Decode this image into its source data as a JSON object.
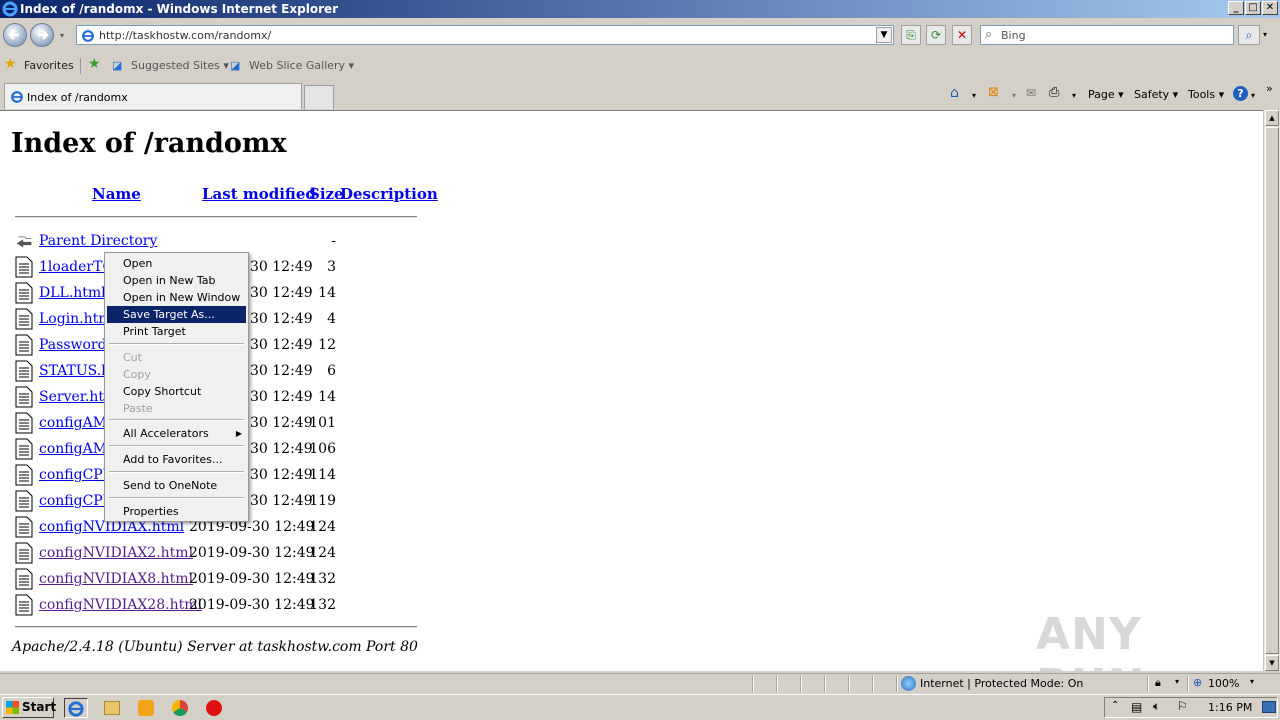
{
  "window": {
    "title": "Index of /randomx - Windows Internet Explorer",
    "minimize": "_",
    "maximize": "□",
    "close": "✕"
  },
  "address": {
    "url": "http://taskhostw.com/randomx/",
    "search_placeholder": "Bing"
  },
  "favorites_bar": {
    "favorites": "Favorites",
    "suggested_sites": "Suggested Sites ▾",
    "web_slice_gallery": "Web Slice Gallery ▾"
  },
  "tab": {
    "label": "Index of /randomx"
  },
  "command_bar": {
    "page": "Page ▾",
    "safety": "Safety ▾",
    "tools": "Tools ▾",
    "help": "?"
  },
  "page": {
    "heading": "Index of /randomx",
    "columns": {
      "name": "Name",
      "last_modified": "Last modified",
      "size": "Size",
      "description": "Description"
    },
    "parent": {
      "name": "Parent Directory",
      "size": "-"
    },
    "files": [
      {
        "name": "1loaderTC",
        "date": "30 12:49",
        "size": "3"
      },
      {
        "name": "DLL.html",
        "date": "30 12:49",
        "size": "14"
      },
      {
        "name": "Login.html",
        "date": "30 12:49",
        "size": "4"
      },
      {
        "name": "Password.",
        "date": "30 12:49",
        "size": "12"
      },
      {
        "name": "STATUS.h",
        "date": "30 12:49",
        "size": "6"
      },
      {
        "name": "Server.htm",
        "date": "30 12:49",
        "size": "14"
      },
      {
        "name": "configAMI",
        "date": "30 12:49",
        "size": "101"
      },
      {
        "name": "configAMI",
        "date": "30 12:49",
        "size": "106"
      },
      {
        "name": "configCPU",
        "date": "30 12:49",
        "size": "114"
      },
      {
        "name": "configCPU",
        "date": "30 12:49",
        "size": "119"
      },
      {
        "name": "configNVIDIAX.html",
        "date": "2019-09-30 12:49",
        "size": "124"
      },
      {
        "name": "configNVIDIAX2.html",
        "date": "2019-09-30 12:49",
        "size": "124"
      },
      {
        "name": "configNVIDIAX8.html",
        "date": "2019-09-30 12:49",
        "size": "132"
      },
      {
        "name": "configNVIDIAX28.html",
        "date": "2019-09-30 12:49",
        "size": "132"
      }
    ],
    "footer": "Apache/2.4.18 (Ubuntu) Server at taskhostw.com Port 80"
  },
  "context_menu": {
    "open": "Open",
    "open_new_tab": "Open in New Tab",
    "open_new_window": "Open in New Window",
    "save_target_as": "Save Target As...",
    "print_target": "Print Target",
    "cut": "Cut",
    "copy": "Copy",
    "copy_shortcut": "Copy Shortcut",
    "paste": "Paste",
    "all_accelerators": "All Accelerators",
    "add_to_favorites": "Add to Favorites...",
    "send_to_onenote": "Send to OneNote",
    "properties": "Properties"
  },
  "status_bar": {
    "zone": "Internet | Protected Mode: On",
    "zoom": "100%"
  },
  "taskbar": {
    "start": "Start",
    "clock": "1:16 PM"
  },
  "watermark": "ANY RUN",
  "colors": {
    "link": "#0000ee",
    "visited": "#551a8b",
    "menu_highlight": "#0a246a"
  }
}
